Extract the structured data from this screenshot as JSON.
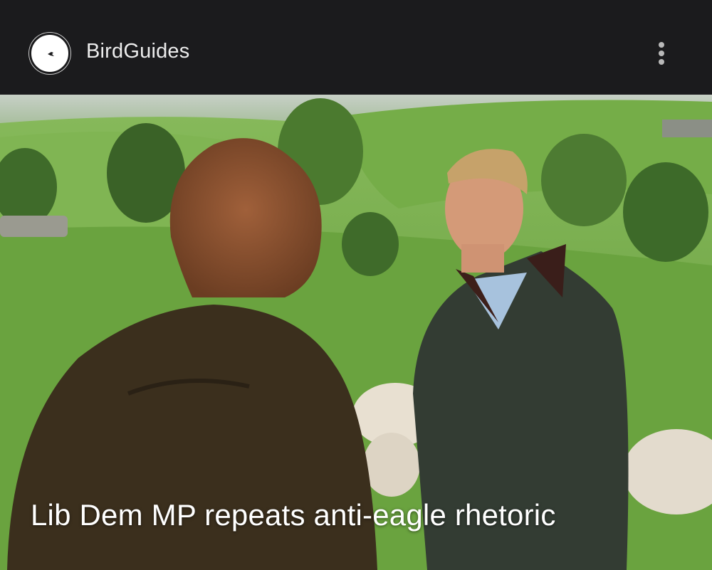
{
  "app_bar": {
    "title": "BirdGuides",
    "logo_icon": "bird-logo-icon",
    "menu_icon": "more-vert-icon"
  },
  "article": {
    "headline": "Lib Dem MP repeats anti-eagle rhetoric",
    "image_description_icon": "article-photo"
  },
  "colors": {
    "app_bar_background": "#1b1b1d",
    "title_text": "#ececec",
    "headline_text": "#ffffff"
  }
}
